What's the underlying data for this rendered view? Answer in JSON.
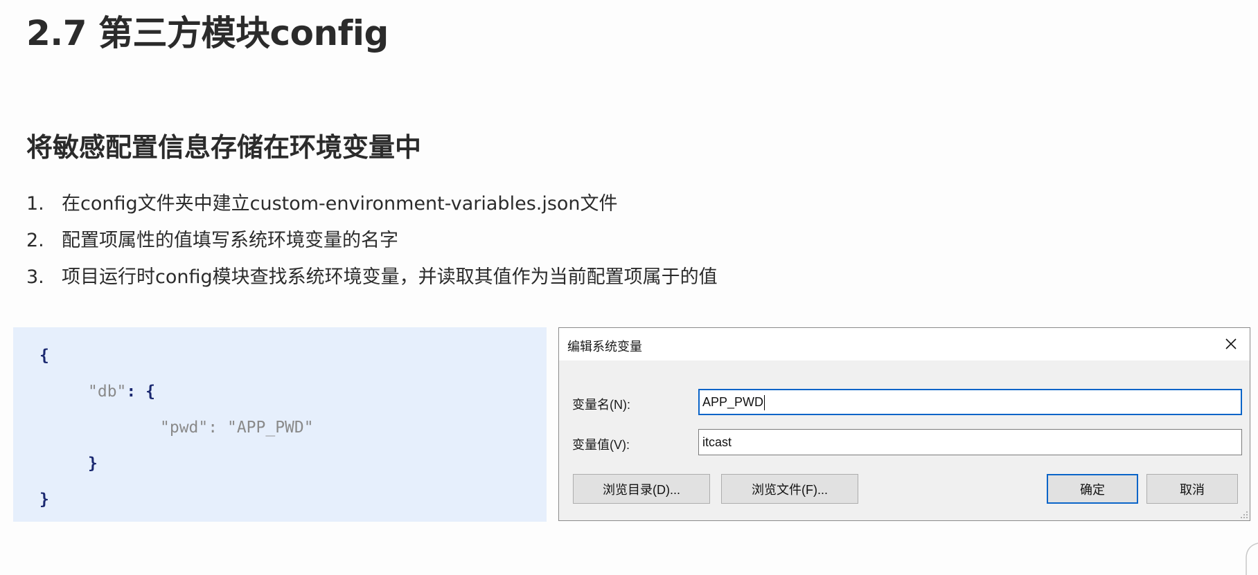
{
  "slide": {
    "title": "2.7 第三方模块config",
    "subtitle": "将敏感配置信息存储在环境变量中",
    "steps": [
      {
        "num": "1.",
        "text": "在config文件夹中建立custom-environment-variables.json文件"
      },
      {
        "num": "2.",
        "text": "配置项属性的值填写系统环境变量的名字"
      },
      {
        "num": "3.",
        "text": "项目运行时config模块查找系统环境变量，并读取其值作为当前配置项属于的值"
      }
    ]
  },
  "code": {
    "open_brace": "{",
    "db_key": "\"db\"",
    "colon": ":",
    "inner_open": "{",
    "pwd_key": "\"pwd\"",
    "pwd_value": "\"APP_PWD\"",
    "inner_close": "}",
    "close_brace": "}"
  },
  "dialog": {
    "title": "编辑系统变量",
    "close_icon": "close-icon",
    "name_label": "变量名(N):",
    "name_value": "APP_PWD",
    "value_label": "变量值(V):",
    "value_value": "itcast",
    "browse_dir_label": "浏览目录(D)...",
    "browse_file_label": "浏览文件(F)...",
    "ok_label": "确定",
    "cancel_label": "取消",
    "accent_color": "#0a64c8"
  }
}
